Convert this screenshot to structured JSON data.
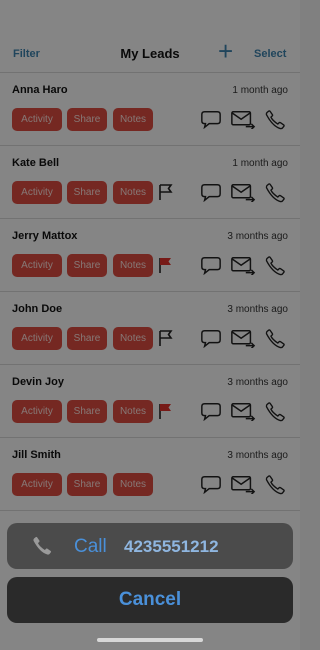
{
  "header": {
    "filter_label": "Filter",
    "title": "My Leads",
    "add_symbol": "+",
    "select_label": "Select"
  },
  "leads": [
    {
      "name": "Anna Haro",
      "time": "1 month ago",
      "flag": "none"
    },
    {
      "name": "Kate Bell",
      "time": "1 month ago",
      "flag": "outline"
    },
    {
      "name": "Jerry Mattox",
      "time": "3 months ago",
      "flag": "red"
    },
    {
      "name": "John Doe",
      "time": "3 months ago",
      "flag": "outline"
    },
    {
      "name": "Devin Joy",
      "time": "3 months ago",
      "flag": "red"
    },
    {
      "name": "Jill Smith",
      "time": "3 months ago",
      "flag": "none"
    }
  ],
  "lead_buttons": {
    "activity": "Activity",
    "share": "Share",
    "notes": "Notes"
  },
  "action_sheet": {
    "call_label": "Call",
    "phone_number": "4235551212",
    "cancel_label": "Cancel"
  },
  "colors": {
    "accent": "#3b7ea8",
    "button_red": "#d54a3e",
    "flag_red": "#d9302a",
    "sheet_blue": "#4a90d9"
  }
}
